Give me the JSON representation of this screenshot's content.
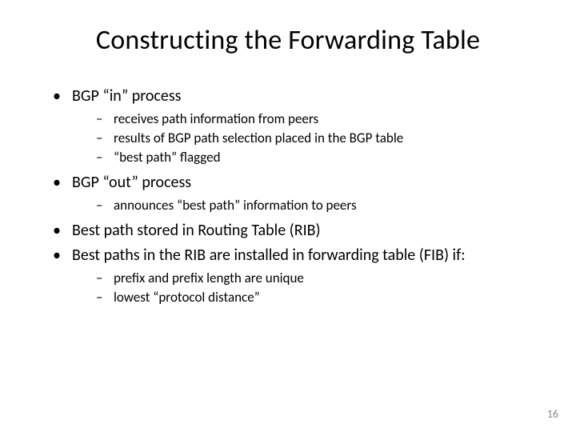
{
  "title": "Constructing the Forwarding Table",
  "bullets": [
    {
      "text": "BGP “in” process",
      "sub": [
        "receives path information from peers",
        "results of BGP path selection placed in the BGP table",
        "“best path” flagged"
      ]
    },
    {
      "text": "BGP “out” process",
      "sub": [
        "announces “best path” information to peers"
      ]
    },
    {
      "text": "Best path stored in Routing Table (RIB)",
      "sub": []
    },
    {
      "text": "Best paths in the RIB are installed in forwarding table (FIB) if:",
      "sub": [
        "prefix and prefix length are unique",
        "lowest “protocol distance”"
      ]
    }
  ],
  "pageNumber": "16"
}
